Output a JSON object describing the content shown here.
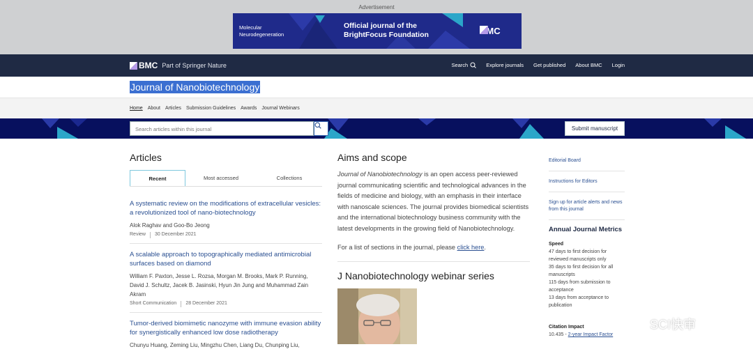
{
  "ad": {
    "label": "Advertisement",
    "left_line1": "Molecular",
    "left_line2": "Neurodegeneration",
    "mid_line1": "Official journal of the",
    "mid_line2": "BrightFocus Foundation",
    "logo": "BMC"
  },
  "topnav": {
    "brand": "BMC",
    "brand_tagline": "Part of Springer Nature",
    "links": [
      "Search",
      "Explore journals",
      "Get published",
      "About BMC",
      "Login"
    ]
  },
  "journal": {
    "title": "Journal of Nanobiotechnology"
  },
  "subnav": {
    "links": [
      "Home",
      "About",
      "Articles",
      "Submission Guidelines",
      "Awards",
      "Journal Webinars"
    ]
  },
  "search": {
    "placeholder": "Search articles within this journal",
    "submit_label": "Submit manuscript"
  },
  "articles": {
    "heading": "Articles",
    "tabs": [
      "Recent",
      "Most accessed",
      "Collections"
    ],
    "items": [
      {
        "title": "A systematic review on the modifications of extracellular vesicles: a revolutionized tool of nano-biotechnology",
        "authors": "Alok Raghav and Goo-Bo Jeong",
        "type": "Review",
        "date": "30 December 2021"
      },
      {
        "title": "A scalable approach to topographically mediated antimicrobial surfaces based on diamond",
        "authors": "William F. Paxton, Jesse L. Rozsa, Morgan M. Brooks, Mark P. Running, David J. Schultz, Jacek B. Jasinski, Hyun Jin Jung and Muhammad Zain Akram",
        "type": "Short Communication",
        "date": "28 December 2021"
      },
      {
        "title": "Tumor-derived biomimetic nanozyme with immune evasion ability for synergistically enhanced low dose radiotherapy",
        "authors": "Chunyu Huang, Zeming Liu, Mingzhu Chen, Liang Du, Chunping Liu,",
        "type": "",
        "date": ""
      }
    ]
  },
  "aims": {
    "heading": "Aims and scope",
    "journal_italic": "Journal of Nanobiotechnology",
    "body": " is an open access peer-reviewed journal communicating scientific and technological advances in the fields of medicine and biology, with an emphasis in their interface with nanoscale sciences. The journal provides biomedical scientists and the international biotechnology business community with the latest developments in the growing field of Nanobiotechnology.",
    "sections_text": "For a list of sections in the journal, please ",
    "sections_link": "click here",
    "sections_end": "."
  },
  "webinar": {
    "heading": "J Nanobiotechnology webinar series"
  },
  "sidebar": {
    "links": [
      "Editorial Board",
      "Instructions for Editors",
      "Sign up for article alerts and news from this journal"
    ],
    "metrics_heading": "Annual Journal Metrics",
    "speed_label": "Speed",
    "speed_lines": [
      "47 days to first decision for reviewed manuscripts only",
      "35 days to first decision for all manuscripts",
      "115 days from submission to acceptance",
      "13 days from acceptance to publication"
    ],
    "citation_label": "Citation Impact",
    "citation_value": "10.435 - ",
    "citation_link": "2-year Impact Factor"
  },
  "watermark": {
    "text": "SCI快审"
  },
  "colors": {
    "topnav_bg": "#1f2a44",
    "band_bg": "#07105e",
    "link": "#2a4f91",
    "accent_cyan": "#2ba6c9"
  }
}
